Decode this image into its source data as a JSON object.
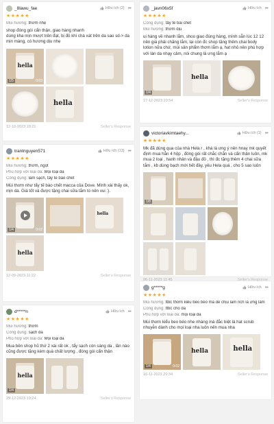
{
  "response_label": "Seller's Response",
  "field_labels": {
    "scent": "Mùi hương:",
    "use": "Công dụng:",
    "skin": "Phù hợp với loại da:"
  },
  "reviews": [
    {
      "user": "_8lawu_fae",
      "helpful": "Hữu ích (2)",
      "scent": "thơm nhẹ",
      "body": "shop đóng gói cẩn thận, giao hàng nhanh\ndùng kha mịn mượt trên đạt, bị đỏ khi chà xát trên da sau sd-> da mịn màng, có hương dịu nhẹ",
      "photo_badges": [
        "1/5",
        "0:03"
      ],
      "date": "12-10-2023 10:21"
    },
    {
      "user": "trantnguyen571",
      "helpful": "Hữu ích (13)",
      "scent": "thơm, ngọt",
      "skin": "Mọi loại da",
      "use": "làm sạch, tẩy tế bào chết",
      "body": "Mùi thơm như tẩy tế bào chết macca của Dove. Mình xài thấy ok, mịn da. Giá tốt và được tặng chai sữa tắm to nên vui :).",
      "photo_badges": [
        "1/4",
        "0:02"
      ],
      "date": "12-09-2023 11:22"
    },
    {
      "user": "d*****n",
      "helpful": "Hữu ích",
      "scent": "thơm",
      "use": "sạch da",
      "skin": "Mọi loại da",
      "body": "Mua bên shop hũ thứ 2 xài rất ok , tẩy sạch còn sáng da , lần nào cũng được tặng kèm quà chất lượng , đóng gói cẩn thận",
      "photo_badges": [
        "1/4"
      ],
      "date": "29-12-2023 19:24"
    },
    {
      "user": "_javn06x5f",
      "helpful": "Hữu ích",
      "use": "tẩy tế bài chết",
      "scent": "thơm dịu",
      "body": "ui hàng về nhanh lắm, shoo giao đúng hàng, mình sẵn lúc 12 12 nên giá phải chăng lắm, lại còn đc shop tặng thêm chai body lotion nữa chứ, mùi sản phẩm thơm lắm ạ, hat nhỏ nên phù hợp với làn da nhạy cảm, nói chung là ưng lắm ạ",
      "photo_badges": [
        "1/4"
      ],
      "date": "17-12-2023 20:54"
    },
    {
      "user": "victoriavkimtaehy...",
      "helpful": "Hữu ích (1)",
      "body": "Mk đã dùng qua của nhà Hela r , khá là ưng ý nên hnay mk quyết định mua hẳn 4 hộp , đóng gói rất chắc chắn và cẩn thận luôn, mk mua 2 loại , hanh nhân và đậu đỏ , thì đc tặng thêm 4 chai sữa tắm , kb dùng bạch mới hết đây, yêu Hela quá , cho 5 sao luôn",
      "photo_badges": [
        "1/8"
      ],
      "date": "06-11-2023 11:45"
    },
    {
      "user": "g*****g",
      "helpful": "Hữu ích",
      "scent": "ttbc thơm kiểu beo béo mà dễ chịu lắm nch là ưng lắm",
      "use": "ttbc cho da",
      "skin": "mọi loại da",
      "body": "Mùi thơm kiểu beo béo nhe nhàng mà đắc biệt là hat scrub nhuyễn dành cho mọi loại nha luôn nên mua nha",
      "photo_badges": [
        "1/4",
        "0:02"
      ],
      "date": "16-11-2023 20:34"
    }
  ],
  "brand_text": "hella",
  "icons": {
    "helpful": "thumb-up-icon",
    "menu": "more-dots-icon",
    "stars": "star-rating-icon"
  },
  "colors": {
    "star": "#f5a623",
    "muted": "#888888"
  }
}
